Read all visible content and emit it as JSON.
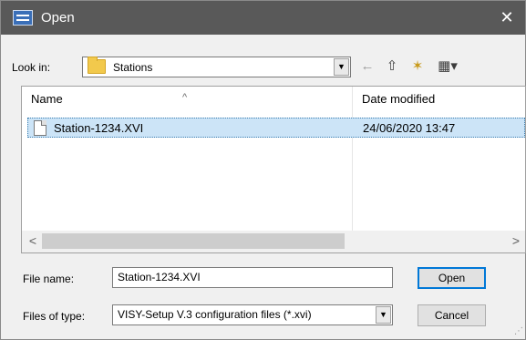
{
  "window": {
    "title": "Open",
    "close_glyph": "✕",
    "app_icon": "app-window-icon"
  },
  "look_in": {
    "label": "Look in:",
    "value": "Stations",
    "folder_icon": "folder-icon",
    "dropdown_glyph": "▼"
  },
  "toolbar": {
    "back_glyph": "←",
    "back_icon": "back-arrow-icon",
    "up_glyph": "⇧",
    "up_icon": "up-folder-icon",
    "new_glyph": "✶",
    "new_icon": "new-folder-icon",
    "view_glyph": "▦▾",
    "view_icon": "view-menu-icon"
  },
  "file_list": {
    "columns": [
      "Name",
      "Date modified"
    ],
    "sort_glyph": "^",
    "rows": [
      {
        "name": "Station-1234.XVI",
        "date": "24/06/2020 13:47",
        "selected": true
      }
    ],
    "scroll_left_glyph": "<",
    "scroll_right_glyph": ">"
  },
  "file_name": {
    "label": "File name:",
    "value": "Station-1234.XVI"
  },
  "file_type": {
    "label": "Files of type:",
    "value": "VISY-Setup V.3 configuration files (*.xvi)",
    "dropdown_glyph": "▼"
  },
  "buttons": {
    "open": "Open",
    "cancel": "Cancel"
  },
  "colors": {
    "titlebar": "#595959",
    "selection": "#cce4f7",
    "accent": "#0078d7"
  }
}
